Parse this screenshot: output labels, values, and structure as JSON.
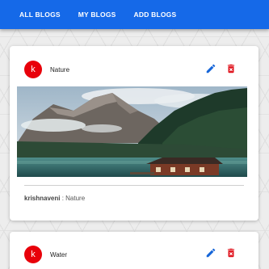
{
  "nav": {
    "all_blogs": "ALL BLOGS",
    "my_blogs": "MY BLOGS",
    "add_blogs": "ADD BLOGS"
  },
  "colors": {
    "appbar": "#1569e8",
    "avatar": "#e8000a",
    "edit_icon": "#1565d8",
    "delete_icon": "#e0141e"
  },
  "posts": [
    {
      "avatar_letter": "k",
      "title": "Nature",
      "author": "krishnaveni",
      "separator": " : ",
      "category": "Nature",
      "image": "landscape-photo",
      "edit_icon": "pencil-icon",
      "delete_icon": "trash-icon"
    },
    {
      "avatar_letter": "k",
      "title": "Water",
      "edit_icon": "pencil-icon",
      "delete_icon": "trash-icon"
    }
  ]
}
